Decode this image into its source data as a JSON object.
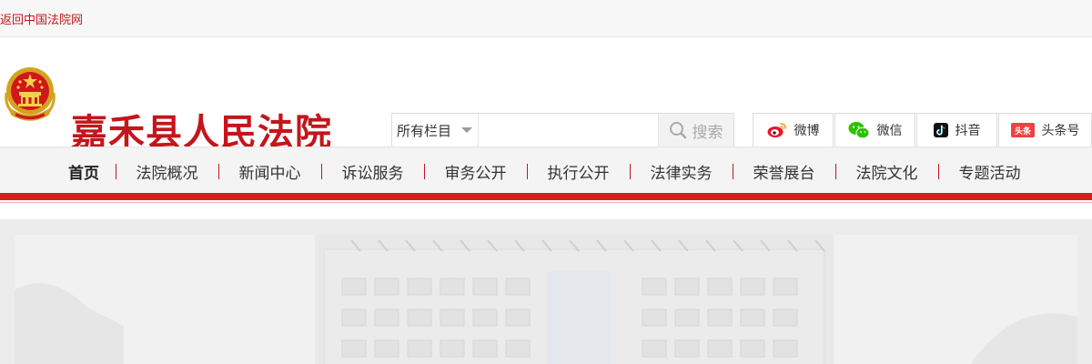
{
  "topbar": {
    "back_link": "返回中国法院网"
  },
  "header": {
    "site_title": "嘉禾县人民法院"
  },
  "search": {
    "scope_label": "所有栏目",
    "input_value": "",
    "button_label": "搜索"
  },
  "social": [
    {
      "label": "微博",
      "icon": "weibo-icon"
    },
    {
      "label": "微信",
      "icon": "wechat-icon"
    },
    {
      "label": "抖音",
      "icon": "douyin-icon"
    },
    {
      "label": "头条号",
      "icon": "toutiao-icon",
      "icon_text": "头条"
    }
  ],
  "nav": {
    "items": [
      {
        "label": "首页",
        "active": true
      },
      {
        "label": "法院概况"
      },
      {
        "label": "新闻中心"
      },
      {
        "label": "诉讼服务"
      },
      {
        "label": "审务公开"
      },
      {
        "label": "执行公开"
      },
      {
        "label": "法律实务"
      },
      {
        "label": "荣誉展台"
      },
      {
        "label": "法院文化"
      },
      {
        "label": "专题活动"
      }
    ]
  },
  "colors": {
    "brand_red": "#c3161c",
    "nav_bar_red": "#d51c21"
  }
}
